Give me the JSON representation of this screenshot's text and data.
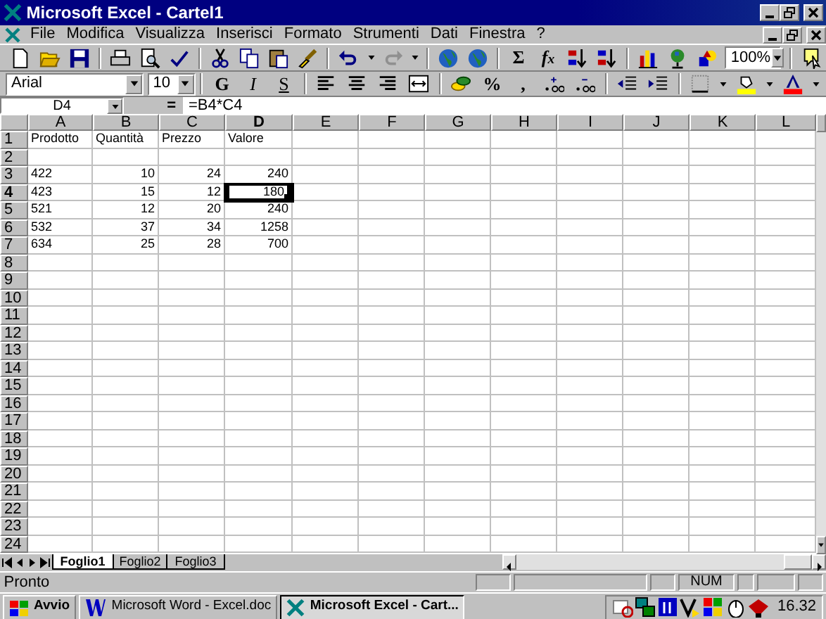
{
  "window": {
    "title": "Microsoft Excel - Cartel1"
  },
  "menu": [
    "File",
    "Modifica",
    "Visualizza",
    "Inserisci",
    "Formato",
    "Strumenti",
    "Dati",
    "Finestra",
    "?"
  ],
  "standard_toolbar": {
    "text_buttons": [
      "Σ",
      "f$_{x}$"
    ],
    "zoom": "100%"
  },
  "formatting_toolbar": {
    "font": "Arial",
    "size": "10",
    "style_buttons": [
      "G",
      "I",
      "S"
    ],
    "number_buttons": [
      "%",
      ","
    ]
  },
  "formula_bar": {
    "name_box": "D4",
    "equals": "=",
    "formula": "=B4*C4"
  },
  "sheet": {
    "columns": [
      "A",
      "B",
      "C",
      "D",
      "E",
      "F",
      "G",
      "H",
      "I",
      "J",
      "K",
      "L"
    ],
    "rows": [
      {
        "label": "1",
        "cells": [
          {
            "text": "Prodotto",
            "numeric": false,
            "selected": false
          },
          {
            "text": "Quantità",
            "numeric": false,
            "selected": false
          },
          {
            "text": "Prezzo",
            "numeric": false,
            "selected": false
          },
          {
            "text": "Valore",
            "numeric": false,
            "selected": false
          }
        ]
      },
      {
        "label": "2",
        "cells": []
      },
      {
        "label": "3",
        "cells": [
          {
            "text": "422",
            "numeric": false,
            "selected": false
          },
          {
            "text": "10",
            "numeric": true,
            "selected": false
          },
          {
            "text": "24",
            "numeric": true,
            "selected": false
          },
          {
            "text": "240",
            "numeric": true,
            "selected": false
          }
        ]
      },
      {
        "label": "4",
        "cells": [
          {
            "text": "423",
            "numeric": false,
            "selected": false
          },
          {
            "text": "15",
            "numeric": true,
            "selected": false
          },
          {
            "text": "12",
            "numeric": true,
            "selected": false
          },
          {
            "text": "180",
            "numeric": true,
            "selected": true
          }
        ]
      },
      {
        "label": "5",
        "cells": [
          {
            "text": "521",
            "numeric": false,
            "selected": false
          },
          {
            "text": "12",
            "numeric": true,
            "selected": false
          },
          {
            "text": "20",
            "numeric": true,
            "selected": false
          },
          {
            "text": "240",
            "numeric": true,
            "selected": false
          }
        ]
      },
      {
        "label": "6",
        "cells": [
          {
            "text": "532",
            "numeric": false,
            "selected": false
          },
          {
            "text": "37",
            "numeric": true,
            "selected": false
          },
          {
            "text": "34",
            "numeric": true,
            "selected": false
          },
          {
            "text": "1258",
            "numeric": true,
            "selected": false
          }
        ]
      },
      {
        "label": "7",
        "cells": [
          {
            "text": "634",
            "numeric": false,
            "selected": false
          },
          {
            "text": "25",
            "numeric": true,
            "selected": false
          },
          {
            "text": "28",
            "numeric": true,
            "selected": false
          },
          {
            "text": "700",
            "numeric": true,
            "selected": false
          }
        ]
      },
      {
        "label": "8",
        "cells": []
      },
      {
        "label": "9",
        "cells": []
      },
      {
        "label": "10",
        "cells": []
      },
      {
        "label": "11",
        "cells": []
      },
      {
        "label": "12",
        "cells": []
      },
      {
        "label": "13",
        "cells": []
      },
      {
        "label": "14",
        "cells": []
      },
      {
        "label": "15",
        "cells": []
      },
      {
        "label": "16",
        "cells": []
      },
      {
        "label": "17",
        "cells": []
      },
      {
        "label": "18",
        "cells": []
      },
      {
        "label": "19",
        "cells": []
      },
      {
        "label": "20",
        "cells": []
      },
      {
        "label": "21",
        "cells": []
      },
      {
        "label": "22",
        "cells": []
      },
      {
        "label": "23",
        "cells": []
      },
      {
        "label": "24",
        "cells": []
      }
    ]
  },
  "sheet_tabs": [
    {
      "label": "Foglio1",
      "selected": true
    },
    {
      "label": "Foglio2",
      "selected": false
    },
    {
      "label": "Foglio3",
      "selected": false
    }
  ],
  "status_bar": {
    "message": "Pronto",
    "indicator": "NUM"
  },
  "taskbar": {
    "start": "Avvio",
    "tasks": [
      {
        "label": "Microsoft Word - Excel.doc",
        "selected": false
      },
      {
        "label": "Microsoft Excel - Cart...",
        "selected": true
      }
    ],
    "clock": "16.32"
  }
}
